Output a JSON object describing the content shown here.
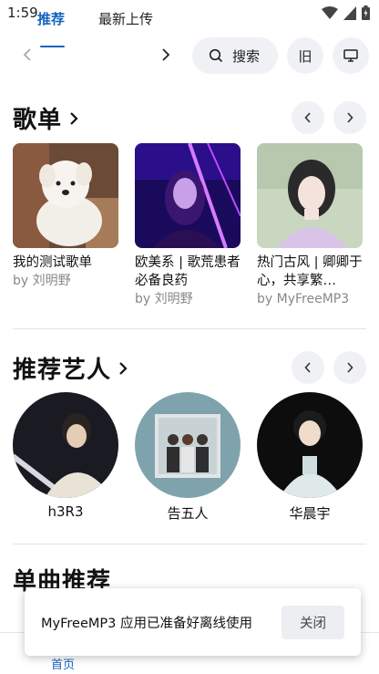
{
  "status": {
    "time": "1:59"
  },
  "nav": {
    "tabs": [
      {
        "label": "推荐"
      },
      {
        "label": "最新上传"
      }
    ],
    "search_label": "搜索",
    "old_label": "旧"
  },
  "playlists": {
    "title": "歌单",
    "items": [
      {
        "title": "我的测试歌单",
        "by": "by 刘明野"
      },
      {
        "title": "欧美系 | 歌荒患者必备良药",
        "by": "by 刘明野"
      },
      {
        "title": "热门古风 | 卿卿于心，共享繁…",
        "by": "by MyFreeMP3"
      }
    ]
  },
  "artists": {
    "title": "推荐艺人",
    "items": [
      {
        "name": "h3R3"
      },
      {
        "name": "告五人"
      },
      {
        "name": "华晨宇"
      }
    ]
  },
  "singles": {
    "title": "单曲推荐"
  },
  "toast": {
    "message": "MyFreeMP3 应用已准备好离线使用",
    "button": "关闭"
  },
  "bottom_nav": {
    "home": "首页"
  },
  "colors": {
    "accent": "#1565c0",
    "pill_bg": "#eff1f4"
  }
}
